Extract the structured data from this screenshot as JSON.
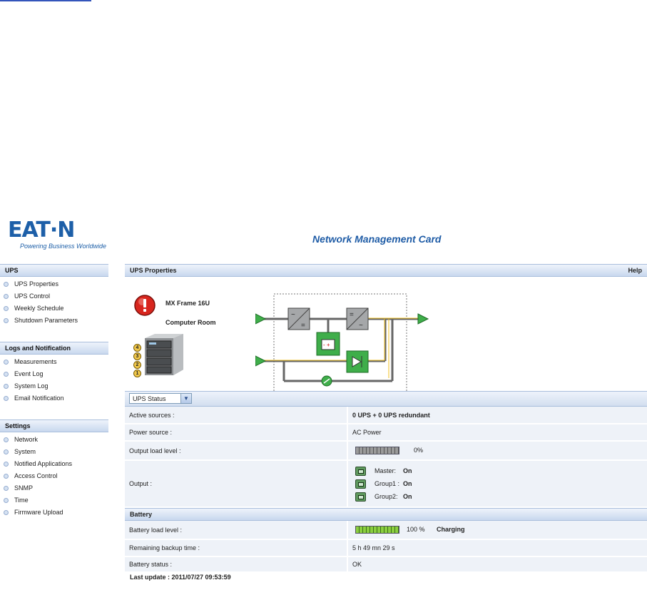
{
  "logo": {
    "word": "EAT·N",
    "tagline": "Powering Business Worldwide"
  },
  "app_title": "Network Management Card",
  "sidebar": {
    "sections": [
      {
        "title": "UPS",
        "items": [
          "UPS Properties",
          "UPS Control",
          "Weekly Schedule",
          "Shutdown Parameters"
        ]
      },
      {
        "title": "Logs and Notification",
        "items": [
          "Measurements",
          "Event Log",
          "System Log",
          "Email Notification"
        ]
      },
      {
        "title": "Settings",
        "items": [
          "Network",
          "System",
          "Notified Applications",
          "Access Control",
          "SNMP",
          "Time",
          "Firmware Upload"
        ]
      }
    ]
  },
  "panel": {
    "title": "UPS Properties",
    "help": "Help",
    "ups_model": "MX Frame 16U",
    "ups_location": "Computer Room",
    "module_numbers": [
      "4",
      "3",
      "2",
      "1"
    ]
  },
  "status_select": {
    "value": "UPS Status"
  },
  "status_rows": {
    "active_sources": {
      "label": "Active sources :",
      "value": "0 UPS + 0 UPS redundant"
    },
    "power_source": {
      "label": "Power source :",
      "value": "AC Power"
    },
    "output_load": {
      "label": "Output load level :",
      "value": "0%",
      "level": 0
    },
    "output": {
      "label": "Output :",
      "groups": [
        {
          "name": "Master:",
          "state": "On"
        },
        {
          "name": "Group1 :",
          "state": "On"
        },
        {
          "name": "Group2:",
          "state": "On"
        }
      ]
    }
  },
  "battery": {
    "title": "Battery",
    "load_label": "Battery load level :",
    "load_value": "100 %",
    "load_level": 1.0,
    "charging": "Charging",
    "backup_label": "Remaining backup time :",
    "backup_value": "5 h 49 mn 29 s",
    "status_label": "Battery status :",
    "status_value": "OK"
  },
  "last_update": "Last update : 2011/07/27 09:53:59",
  "colors": {
    "accent": "#1f5ca6",
    "header_bg": "#c8d8ee",
    "row_bg": "#eef2f8",
    "flow": "#f0c020",
    "green": "#3fae4a"
  }
}
